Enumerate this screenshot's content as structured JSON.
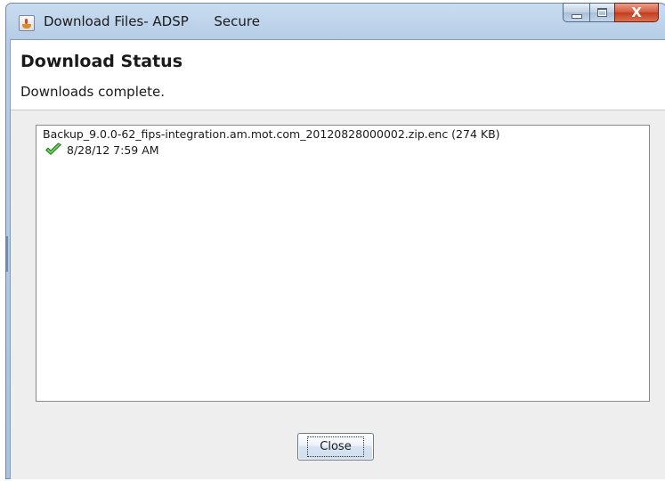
{
  "window": {
    "title": "Download Files- ADSP      Secure",
    "minimize_icon": "minimize-icon",
    "maximize_icon": "maximize-icon",
    "close_glyph": "X"
  },
  "header": {
    "title": "Download Status",
    "subtitle": "Downloads complete."
  },
  "downloads": [
    {
      "file": "Backup_9.0.0-62_fips-integration.am.mot.com_20120828000002.zip.enc (274 KB)",
      "status_icon": "check-icon",
      "timestamp": "8/28/12 7:59 AM"
    }
  ],
  "buttons": {
    "close_label": "Close"
  },
  "colors": {
    "check": "#3ba935",
    "close_button_red": "#c23c1f"
  }
}
